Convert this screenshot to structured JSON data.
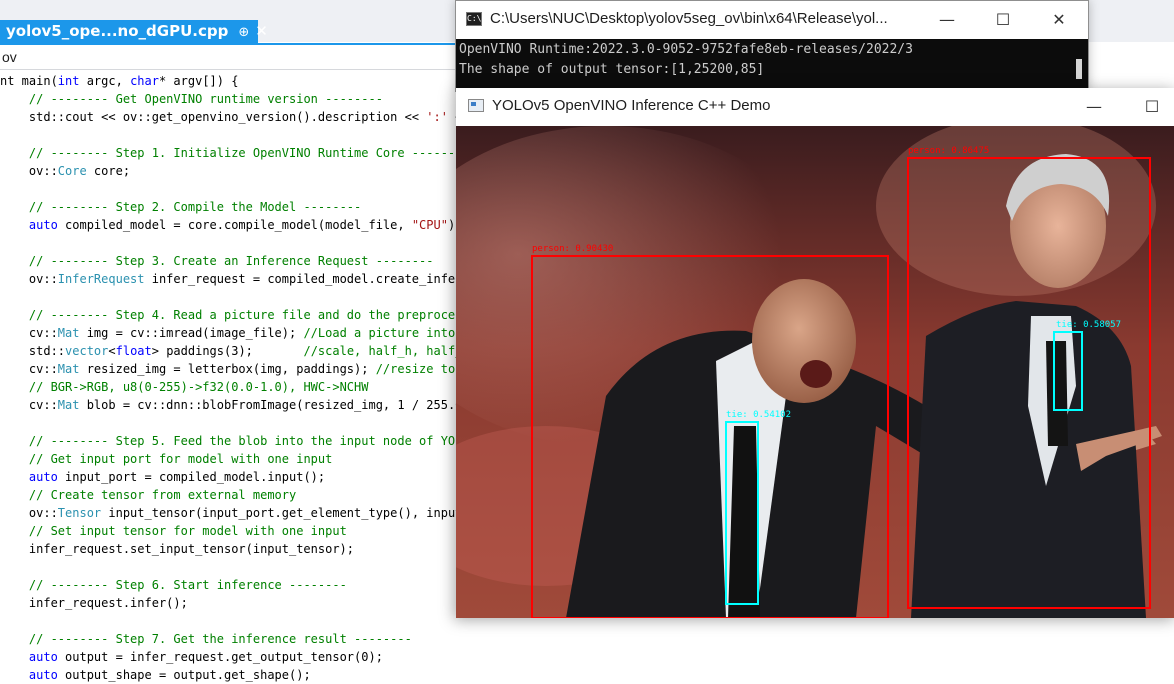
{
  "ide": {
    "tab_title": "yolov5_ope...no_dGPU.cpp",
    "tab_pin_glyph": "⊕",
    "tab_close_glyph": "✕",
    "scope": "ov",
    "code_lines": [
      "nt main(int argc, char* argv[]) {",
      "    // -------- Get OpenVINO runtime version --------",
      "    std::cout << ov::get_openvino_version().description << ':' <<",
      "",
      "    // -------- Step 1. Initialize OpenVINO Runtime Core --------",
      "    ov::Core core;",
      "",
      "    // -------- Step 2. Compile the Model --------",
      "    auto compiled_model = core.compile_model(model_file, \"CPU\"); //",
      "",
      "    // -------- Step 3. Create an Inference Request --------",
      "    ov::InferRequest infer_request = compiled_model.create_infer_r",
      "",
      "    // -------- Step 4. Read a picture file and do the preprocess",
      "    cv::Mat img = cv::imread(image_file); //Load a picture into me",
      "    std::vector<float> paddings(3);       //scale, half_h, half_w",
      "    cv::Mat resized_img = letterbox(img, paddings); //resize to (6",
      "    // BGR->RGB, u8(0-255)->f32(0.0-1.0), HWC->NCHW",
      "    cv::Mat blob = cv::dnn::blobFromImage(resized_img, 1 / 255.0,",
      "",
      "    // -------- Step 5. Feed the blob into the input node of YOLOv",
      "    // Get input port for model with one input",
      "    auto input_port = compiled_model.input();",
      "    // Create tensor from external memory",
      "    ov::Tensor input_tensor(input_port.get_element_type(), input_p",
      "    // Set input tensor for model with one input",
      "    infer_request.set_input_tensor(input_tensor);",
      "",
      "    // -------- Step 6. Start inference --------",
      "    infer_request.infer();",
      "",
      "    // -------- Step 7. Get the inference result --------",
      "    auto output = infer_request.get_output_tensor(0);",
      "    auto output_shape = output.get_shape();"
    ]
  },
  "console": {
    "title": "C:\\Users\\NUC\\Desktop\\yolov5seg_ov\\bin\\x64\\Release\\yol...",
    "icon_text": "C:\\",
    "minimize": "—",
    "maximize": "☐",
    "close": "✕",
    "lines": [
      "OpenVINO Runtime:2022.3.0-9052-9752fafe8eb-releases/2022/3",
      "The shape of output tensor:[1,25200,85]"
    ]
  },
  "inference_window": {
    "title": "YOLOv5 OpenVINO Inference C++ Demo",
    "minimize": "—",
    "maximize": "☐",
    "detections": [
      {
        "label": "person: 0.90430",
        "color": "#ff0000"
      },
      {
        "label": "person: 0.86475",
        "color": "#ff0000"
      },
      {
        "label": "tie: 0.54102",
        "color": "#00ffff"
      },
      {
        "label": "tie: 0.58057",
        "color": "#00ffff"
      }
    ]
  },
  "colors": {
    "accent": "#1c97ea",
    "comment": "#008000",
    "keyword": "#0000ff",
    "type": "#2b91af",
    "string": "#a31515",
    "console_bg": "#0c0c0c",
    "person_box": "#ff0000",
    "tie_box": "#00ffff"
  }
}
